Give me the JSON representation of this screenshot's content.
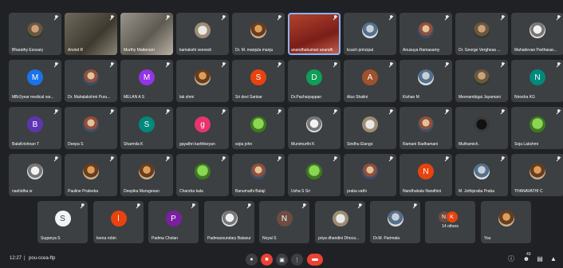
{
  "participants": [
    {
      "name": "Bharathy Essvary",
      "avatar": "photo",
      "letter": ""
    },
    {
      "name": "Arvind R",
      "avatar": "video-a",
      "letter": ""
    },
    {
      "name": "Murthy Matterson",
      "avatar": "video-b",
      "letter": ""
    },
    {
      "name": "kamakshi veeresh",
      "avatar": "photo4",
      "letter": ""
    },
    {
      "name": "Dr. M. manjula manju",
      "avatar": "photo5",
      "letter": ""
    },
    {
      "name": "anandhakumari anandh",
      "avatar": "video-c",
      "letter": ""
    },
    {
      "name": "kcach principal",
      "avatar": "photo8",
      "letter": ""
    },
    {
      "name": "Anusuya Ramasamy",
      "avatar": "photo2",
      "letter": ""
    },
    {
      "name": "Dr. George Vergheas ...",
      "avatar": "photo",
      "letter": ""
    },
    {
      "name": "Mahadevan Parthasar...",
      "avatar": "photo3",
      "letter": ""
    },
    {
      "name": "MBr2year medical var...",
      "avatar": "color",
      "color": "#1a73e8",
      "letter": "M"
    },
    {
      "name": "Dr. Mahalakshmi Puru...",
      "avatar": "photo2",
      "letter": ""
    },
    {
      "name": "MELAN A S",
      "avatar": "color",
      "color": "#9334e6",
      "letter": "M"
    },
    {
      "name": "lak shmi",
      "avatar": "photo5",
      "letter": ""
    },
    {
      "name": "Sri devi Sankar",
      "avatar": "color",
      "color": "#e8430e",
      "letter": "S"
    },
    {
      "name": "Dr.Pachaiyappan",
      "avatar": "color",
      "color": "#0f9d58",
      "letter": "D"
    },
    {
      "name": "Alus Shalini",
      "avatar": "color",
      "color": "#a0522d",
      "letter": "A"
    },
    {
      "name": "Kishan M",
      "avatar": "photo8",
      "letter": ""
    },
    {
      "name": "Meenambigai Jayamani",
      "avatar": "photo",
      "letter": ""
    },
    {
      "name": "Nirosha KG",
      "avatar": "color",
      "color": "#00897b",
      "letter": "N"
    },
    {
      "name": "BalaKrishnan T",
      "avatar": "color",
      "color": "#5e35b1",
      "letter": "B"
    },
    {
      "name": "Deepa S",
      "avatar": "photo2",
      "letter": ""
    },
    {
      "name": "Sharmila K",
      "avatar": "color",
      "color": "#00897b",
      "letter": "S"
    },
    {
      "name": "gayathri karthikeyan",
      "avatar": "color",
      "color": "#e8336e",
      "letter": "g"
    },
    {
      "name": "sojia john",
      "avatar": "photo7",
      "letter": ""
    },
    {
      "name": "Munimurthi K",
      "avatar": "photo3",
      "letter": ""
    },
    {
      "name": "Sindhu Elango",
      "avatar": "photo4",
      "letter": ""
    },
    {
      "name": "Ramani Radhamani",
      "avatar": "photo2",
      "letter": ""
    },
    {
      "name": "Muthamich.",
      "avatar": "photo6",
      "letter": ""
    },
    {
      "name": "Soja Lakshmi",
      "avatar": "photo7",
      "letter": ""
    },
    {
      "name": "nashidha sr",
      "avatar": "photo3",
      "letter": ""
    },
    {
      "name": "Pauline Prateeka",
      "avatar": "photo5",
      "letter": ""
    },
    {
      "name": "Deepika Murugesan",
      "avatar": "photo5",
      "letter": ""
    },
    {
      "name": "Chandra kala",
      "avatar": "photo7",
      "letter": ""
    },
    {
      "name": "Banumathi Balaji",
      "avatar": "photo2",
      "letter": ""
    },
    {
      "name": "Usha S Sri",
      "avatar": "photo7",
      "letter": ""
    },
    {
      "name": "praba vathi",
      "avatar": "photo2",
      "letter": ""
    },
    {
      "name": "Nandhubala Nandhini",
      "avatar": "color",
      "color": "#e8430e",
      "letter": "N"
    },
    {
      "name": "M. Jothipraba Praba",
      "avatar": "photo8",
      "letter": ""
    },
    {
      "name": "THANAVATHI C",
      "avatar": "photo5",
      "letter": ""
    },
    {
      "name": "Suganya S",
      "avatar": "color",
      "color": "#f1f3f4",
      "letter": "S",
      "dark": true
    },
    {
      "name": "leena robin",
      "avatar": "color",
      "color": "#e8430e",
      "letter": "l"
    },
    {
      "name": "Padma Cholan",
      "avatar": "color",
      "color": "#7b1fa2",
      "letter": "P"
    },
    {
      "name": "Padmasoundary Balasur...",
      "avatar": "photo3",
      "letter": ""
    },
    {
      "name": "Noyal S",
      "avatar": "color",
      "color": "#6d4c41",
      "letter": "N"
    },
    {
      "name": "priya dhandini Dhoca...",
      "avatar": "photo4",
      "letter": ""
    },
    {
      "name": "Dr.M. Parimala",
      "avatar": "photo8",
      "letter": ""
    },
    {
      "name": "14 others",
      "avatar": "others",
      "letter": ""
    },
    {
      "name": "You",
      "avatar": "photo5",
      "letter": ""
    }
  ],
  "others_pile": [
    {
      "letter": "N",
      "color": "#6d4c41"
    },
    {
      "letter": "K",
      "color": "#e8430e"
    }
  ],
  "bottom_bar": {
    "time": "12:27",
    "separator": "|",
    "meeting_code": "pou-ccea-ftp",
    "participant_count": "49"
  },
  "icons": {
    "mic": "mic-icon",
    "camera": "camera-icon",
    "present": "present-screen-icon",
    "more": "more-options-icon",
    "end": "end-call-icon",
    "info": "info-icon",
    "people": "people-icon",
    "chat": "chat-icon",
    "activities": "activities-icon"
  }
}
